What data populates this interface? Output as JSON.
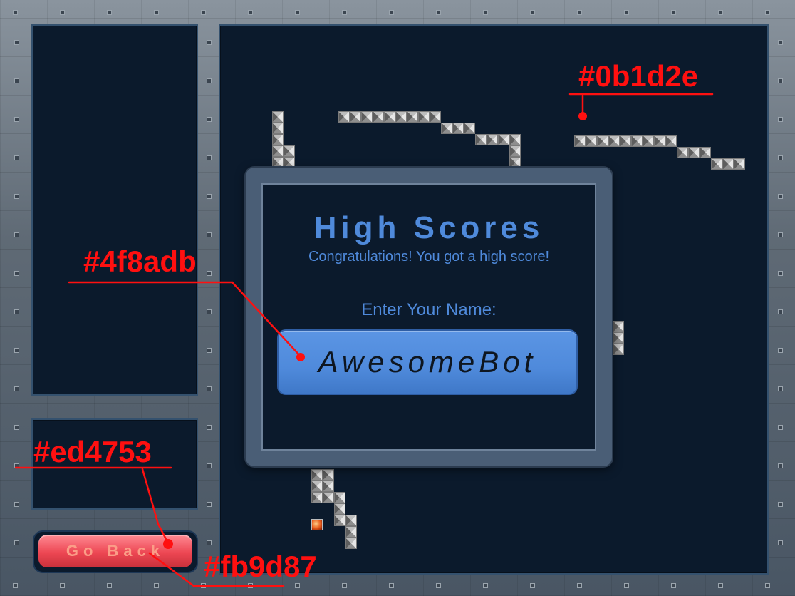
{
  "dialog": {
    "title": "High Scores",
    "subtitle": "Congratulations! You got a high score!",
    "name_label": "Enter Your Name:",
    "name_value": "AwesomeBot"
  },
  "buttons": {
    "go_back_label": "Go Back"
  },
  "annotations": {
    "board_color": "#0b1d2e",
    "input_color": "#4f8adb",
    "button_color": "#ed4753",
    "button_text_color": "#fb9d87"
  },
  "colors": {
    "board": "#0b1a2c",
    "accent_blue": "#4f8adb",
    "button_red": "#ed4753",
    "button_text": "#fb9d87",
    "annotation_red": "#ff1010"
  }
}
